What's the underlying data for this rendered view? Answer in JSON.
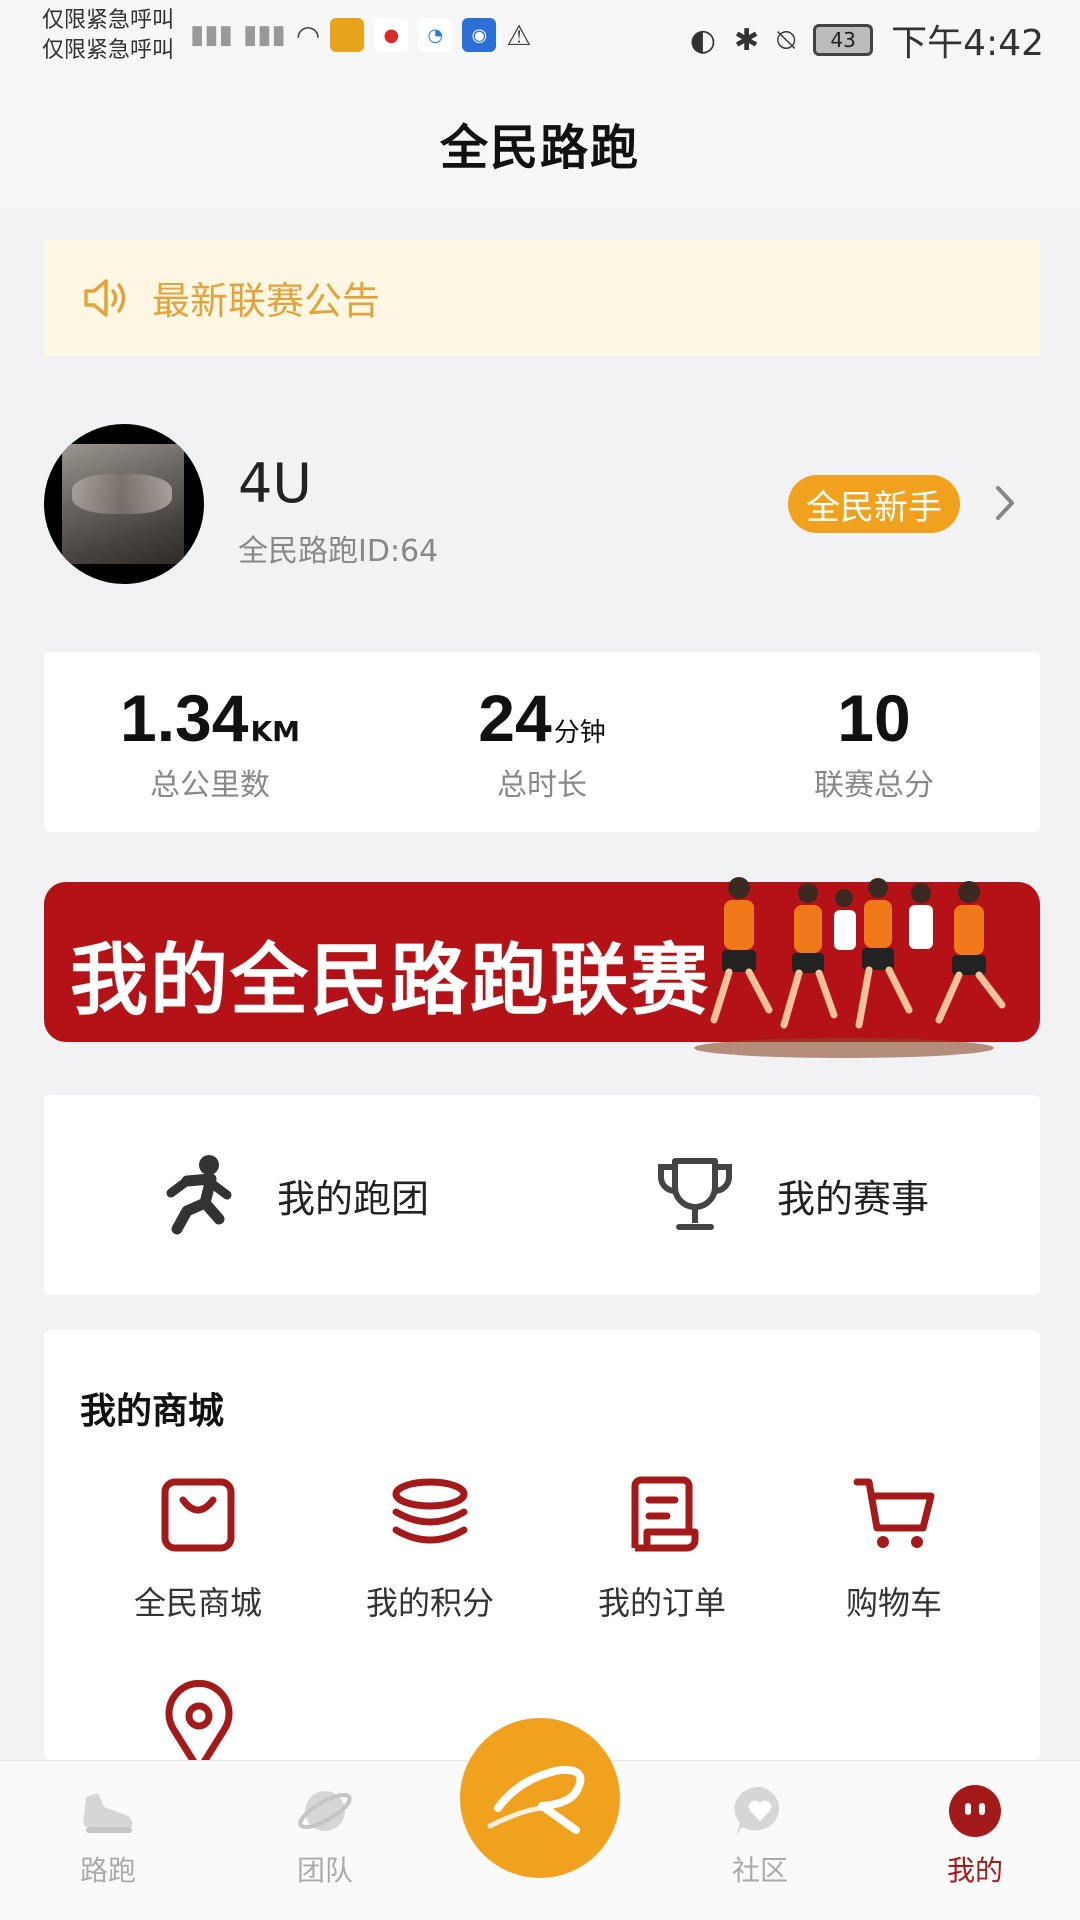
{
  "status_bar": {
    "carrier_line1": "仅限紧急呼叫",
    "carrier_line2": "仅限紧急呼叫",
    "battery": "43",
    "time": "下午4:42"
  },
  "header": {
    "title": "全民路跑"
  },
  "notice": {
    "text": "最新联赛公告"
  },
  "profile": {
    "name": "4U",
    "id_text": "全民路跑ID:64",
    "badge": "全民新手"
  },
  "stats": {
    "distance": {
      "value": "1.34",
      "unit": "KM",
      "label": "总公里数"
    },
    "duration": {
      "value": "24",
      "unit": "分钟",
      "label": "总时长"
    },
    "score": {
      "value": "10",
      "label": "联赛总分"
    }
  },
  "banner": {
    "text": "我的全民路跑联赛"
  },
  "quick": {
    "team_label": "我的跑团",
    "events_label": "我的赛事"
  },
  "mall": {
    "title": "我的商城",
    "items": [
      {
        "label": "全民商城",
        "icon": "shopping-bag-icon"
      },
      {
        "label": "我的积分",
        "icon": "coins-icon"
      },
      {
        "label": "我的订单",
        "icon": "order-icon"
      },
      {
        "label": "购物车",
        "icon": "cart-icon"
      }
    ]
  },
  "tabbar": {
    "items": [
      {
        "label": "路跑",
        "icon": "shoe-icon",
        "active": false
      },
      {
        "label": "团队",
        "icon": "planet-icon",
        "active": false
      },
      {
        "label": "社区",
        "icon": "heart-chat-icon",
        "active": false
      },
      {
        "label": "我的",
        "icon": "face-icon",
        "active": true
      }
    ]
  },
  "colors": {
    "accent_orange": "#f0a11d",
    "brand_red": "#a41a1a",
    "notice_bg": "#fdf7e4",
    "notice_text": "#e3a33a"
  }
}
